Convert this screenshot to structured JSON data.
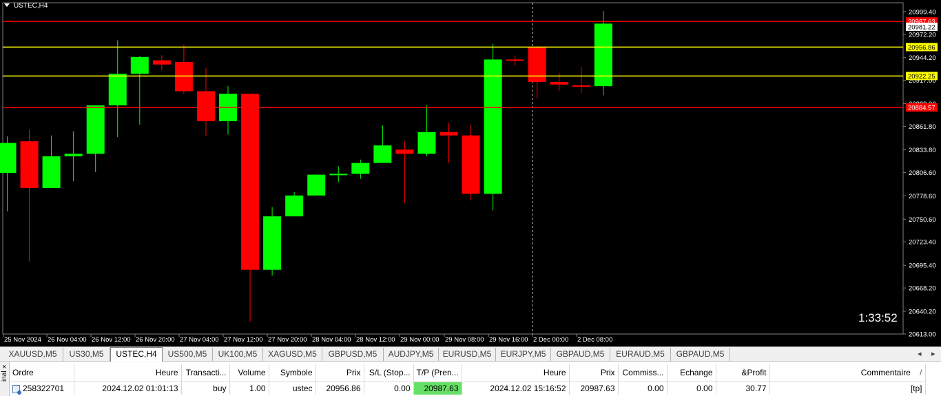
{
  "chart": {
    "symbol_title": "USTEC,H4",
    "timer": "1:33:52",
    "colors": {
      "bull": "#00ff00",
      "bear": "#ff0000",
      "wick": "#c8c8c8",
      "support": "#ffff00",
      "stop": "#ff0000",
      "axis_text": "#ffffff"
    },
    "price_axis": [
      "20999.40",
      "20972.20",
      "20944.20",
      "20917.00",
      "20889.00",
      "20861.80",
      "20833.80",
      "20806.60",
      "20778.60",
      "20750.60",
      "20723.40",
      "20695.40",
      "20668.20",
      "20640.20",
      "20613.00"
    ],
    "time_axis": [
      "25 Nov 2024",
      "26 Nov 04:00",
      "26 Nov 12:00",
      "26 Nov 20:00",
      "27 Nov 04:00",
      "27 Nov 12:00",
      "27 Nov 20:00",
      "28 Nov 04:00",
      "28 Nov 12:00",
      "29 Nov 00:00",
      "29 Nov 08:00",
      "29 Nov 16:00",
      "2 Dec 00:00",
      "2 Dec 08:00"
    ],
    "level_lines": [
      {
        "price": 20987.63,
        "label": "20987.63",
        "type": "stop"
      },
      {
        "price": 20956.86,
        "label": "20956.86",
        "type": "support"
      },
      {
        "price": 20922.25,
        "label": "20922.25",
        "type": "support"
      },
      {
        "price": 20884.57,
        "label": "20884.57",
        "type": "stop"
      }
    ],
    "current_price_label": "20981.22",
    "current_price": 20981.22
  },
  "chart_data": {
    "type": "candlestick",
    "price_range": [
      20613.0,
      21010.0
    ],
    "candles": [
      {
        "o": 20806,
        "h": 20850,
        "l": 20760,
        "c": 20842
      },
      {
        "o": 20844,
        "h": 20858,
        "l": 20700,
        "c": 20788
      },
      {
        "o": 20788,
        "h": 20851,
        "l": 20788,
        "c": 20826
      },
      {
        "o": 20826,
        "h": 20856,
        "l": 20796,
        "c": 20829
      },
      {
        "o": 20829,
        "h": 20874,
        "l": 20807,
        "c": 20887
      },
      {
        "o": 20887,
        "h": 20965,
        "l": 20849,
        "c": 20925
      },
      {
        "o": 20925,
        "h": 20946,
        "l": 20864,
        "c": 20945
      },
      {
        "o": 20941,
        "h": 20947,
        "l": 20929,
        "c": 20936
      },
      {
        "o": 20939,
        "h": 20960,
        "l": 20901,
        "c": 20904
      },
      {
        "o": 20904,
        "h": 20932,
        "l": 20850,
        "c": 20868
      },
      {
        "o": 20868,
        "h": 20910,
        "l": 20852,
        "c": 20901
      },
      {
        "o": 20901,
        "h": 20901,
        "l": 20628,
        "c": 20690
      },
      {
        "o": 20690,
        "h": 20765,
        "l": 20683,
        "c": 20754
      },
      {
        "o": 20754,
        "h": 20783,
        "l": 20756,
        "c": 20779
      },
      {
        "o": 20779,
        "h": 20804,
        "l": 20780,
        "c": 20804
      },
      {
        "o": 20804,
        "h": 20814,
        "l": 20795,
        "c": 20805
      },
      {
        "o": 20805,
        "h": 20822,
        "l": 20799,
        "c": 20818
      },
      {
        "o": 20818,
        "h": 20863,
        "l": 20818,
        "c": 20839
      },
      {
        "o": 20834,
        "h": 20844,
        "l": 20770,
        "c": 20829
      },
      {
        "o": 20829,
        "h": 20887,
        "l": 20826,
        "c": 20855
      },
      {
        "o": 20855,
        "h": 20866,
        "l": 20818,
        "c": 20851
      },
      {
        "o": 20851,
        "h": 20864,
        "l": 20773,
        "c": 20781
      },
      {
        "o": 20781,
        "h": 20961,
        "l": 20761,
        "c": 20942
      },
      {
        "o": 20942,
        "h": 20947,
        "l": 20935,
        "c": 20941
      },
      {
        "o": 20957,
        "h": 20958,
        "l": 20895,
        "c": 20915
      },
      {
        "o": 20915,
        "h": 20926,
        "l": 20904,
        "c": 20912
      },
      {
        "o": 20911,
        "h": 20933,
        "l": 20902,
        "c": 20910
      },
      {
        "o": 20910,
        "h": 21000,
        "l": 20899,
        "c": 20985
      }
    ],
    "xlabel": "",
    "ylabel": ""
  },
  "tabs": [
    {
      "label": "XAUUSD,M5",
      "active": false
    },
    {
      "label": "US30,M5",
      "active": false
    },
    {
      "label": "USTEC,H4",
      "active": true
    },
    {
      "label": "US500,M5",
      "active": false
    },
    {
      "label": "UK100,M5",
      "active": false
    },
    {
      "label": "XAGUSD,M5",
      "active": false
    },
    {
      "label": "GBPUSD,M5",
      "active": false
    },
    {
      "label": "AUDJPY,M5",
      "active": false
    },
    {
      "label": "EURUSD,M5",
      "active": false
    },
    {
      "label": "EURJPY,M5",
      "active": false
    },
    {
      "label": "GBPAUD,M5",
      "active": false
    },
    {
      "label": "EURAUD,M5",
      "active": false
    },
    {
      "label": "GBPAUD,M5",
      "active": false
    }
  ],
  "terminal": {
    "close_glyph": "×",
    "side_label": "inal",
    "columns": [
      "Ordre",
      "Heure",
      "Transacti...",
      "Volume",
      "Symbole",
      "Prix",
      "S/L (Stop...",
      "T/P (Pren...",
      "Heure",
      "Prix",
      "Commiss...",
      "Echange",
      "&Profit",
      "Commentaire"
    ],
    "sort_marker": "/",
    "rows": [
      [
        "258322701",
        "2024.12.02 01:01:13",
        "buy",
        "1.00",
        "ustec",
        "20956.86",
        "0.00",
        "20987.63",
        "2024.12.02 15:16:52",
        "20987.63",
        "0.00",
        "0.00",
        "30.77",
        "[tp]"
      ]
    ]
  }
}
